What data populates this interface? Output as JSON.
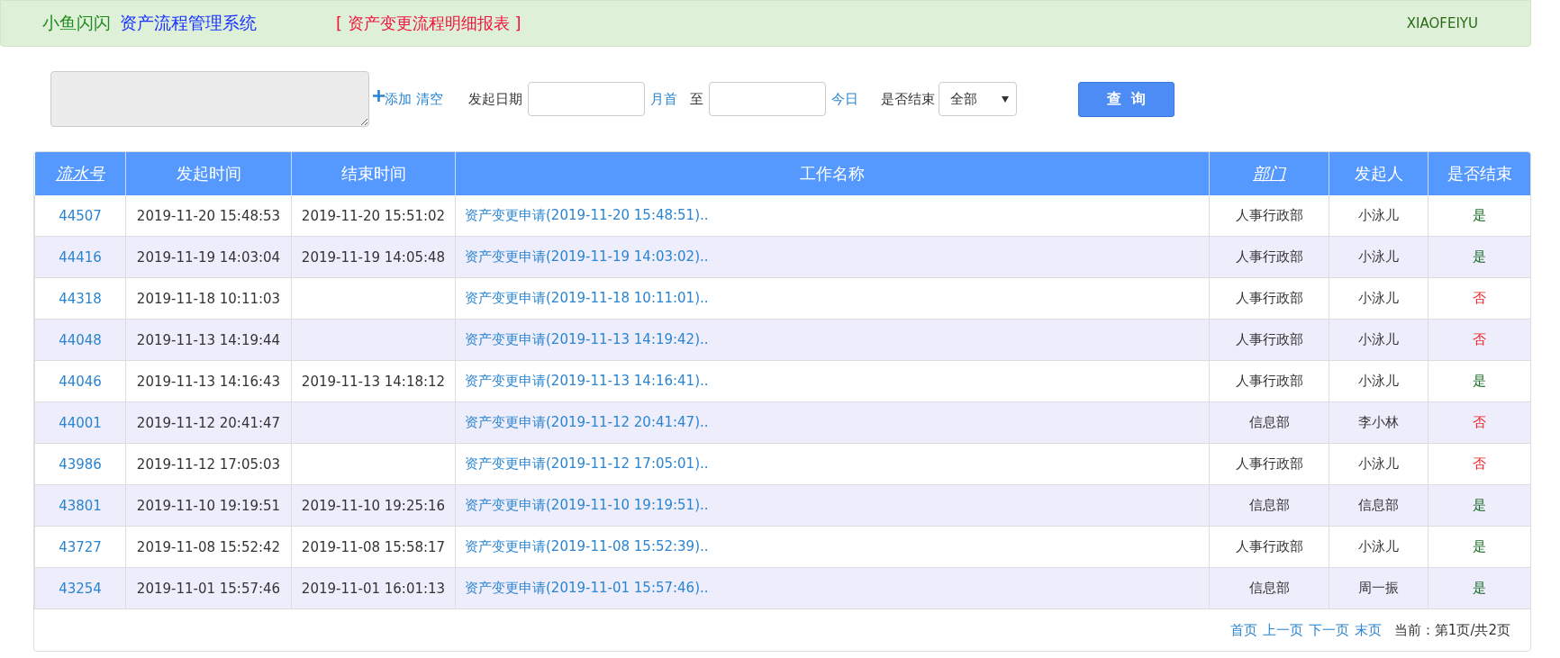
{
  "header": {
    "brand": "小鱼闪闪",
    "system": "资产流程管理系统",
    "report": "[ 资产变更流程明细报表 ]",
    "user": "XIAOFEIYU"
  },
  "filters": {
    "add": "添加",
    "clear": "清空",
    "date_label": "发起日期",
    "month_start": "月首",
    "to": "至",
    "today": "今日",
    "ended_label": "是否结束",
    "ended_value": "全部",
    "query": "查  询"
  },
  "table": {
    "columns": [
      {
        "label": "流水号",
        "sortable": true
      },
      {
        "label": "发起时间",
        "sortable": false
      },
      {
        "label": "结束时间",
        "sortable": false
      },
      {
        "label": "工作名称",
        "sortable": false
      },
      {
        "label": "部门",
        "sortable": true
      },
      {
        "label": "发起人",
        "sortable": false
      },
      {
        "label": "是否结束",
        "sortable": false
      }
    ],
    "rows": [
      {
        "id": "44507",
        "start": "2019-11-20 15:48:53",
        "end": "2019-11-20 15:51:02",
        "name": "资产变更申请(2019-11-20 15:48:51)..",
        "dept": "人事行政部",
        "user": "小泳儿",
        "ended": "是",
        "done": true
      },
      {
        "id": "44416",
        "start": "2019-11-19 14:03:04",
        "end": "2019-11-19 14:05:48",
        "name": "资产变更申请(2019-11-19 14:03:02)..",
        "dept": "人事行政部",
        "user": "小泳儿",
        "ended": "是",
        "done": true
      },
      {
        "id": "44318",
        "start": "2019-11-18 10:11:03",
        "end": "",
        "name": "资产变更申请(2019-11-18 10:11:01)..",
        "dept": "人事行政部",
        "user": "小泳儿",
        "ended": "否",
        "done": false
      },
      {
        "id": "44048",
        "start": "2019-11-13 14:19:44",
        "end": "",
        "name": "资产变更申请(2019-11-13 14:19:42)..",
        "dept": "人事行政部",
        "user": "小泳儿",
        "ended": "否",
        "done": false
      },
      {
        "id": "44046",
        "start": "2019-11-13 14:16:43",
        "end": "2019-11-13 14:18:12",
        "name": "资产变更申请(2019-11-13 14:16:41)..",
        "dept": "人事行政部",
        "user": "小泳儿",
        "ended": "是",
        "done": true
      },
      {
        "id": "44001",
        "start": "2019-11-12 20:41:47",
        "end": "",
        "name": "资产变更申请(2019-11-12 20:41:47)..",
        "dept": "信息部",
        "user": "李小林",
        "ended": "否",
        "done": false
      },
      {
        "id": "43986",
        "start": "2019-11-12 17:05:03",
        "end": "",
        "name": "资产变更申请(2019-11-12 17:05:01)..",
        "dept": "人事行政部",
        "user": "小泳儿",
        "ended": "否",
        "done": false
      },
      {
        "id": "43801",
        "start": "2019-11-10 19:19:51",
        "end": "2019-11-10 19:25:16",
        "name": "资产变更申请(2019-11-10 19:19:51)..",
        "dept": "信息部",
        "user": "信息部",
        "ended": "是",
        "done": true
      },
      {
        "id": "43727",
        "start": "2019-11-08 15:52:42",
        "end": "2019-11-08 15:58:17",
        "name": "资产变更申请(2019-11-08 15:52:39)..",
        "dept": "人事行政部",
        "user": "小泳儿",
        "ended": "是",
        "done": true
      },
      {
        "id": "43254",
        "start": "2019-11-01 15:57:46",
        "end": "2019-11-01 16:01:13",
        "name": "资产变更申请(2019-11-01 15:57:46)..",
        "dept": "信息部",
        "user": "周一振",
        "ended": "是",
        "done": true
      }
    ]
  },
  "pager": {
    "links": [
      "首页",
      "上一页",
      "下一页",
      "末页"
    ],
    "status": "当前：第1页/共2页"
  }
}
